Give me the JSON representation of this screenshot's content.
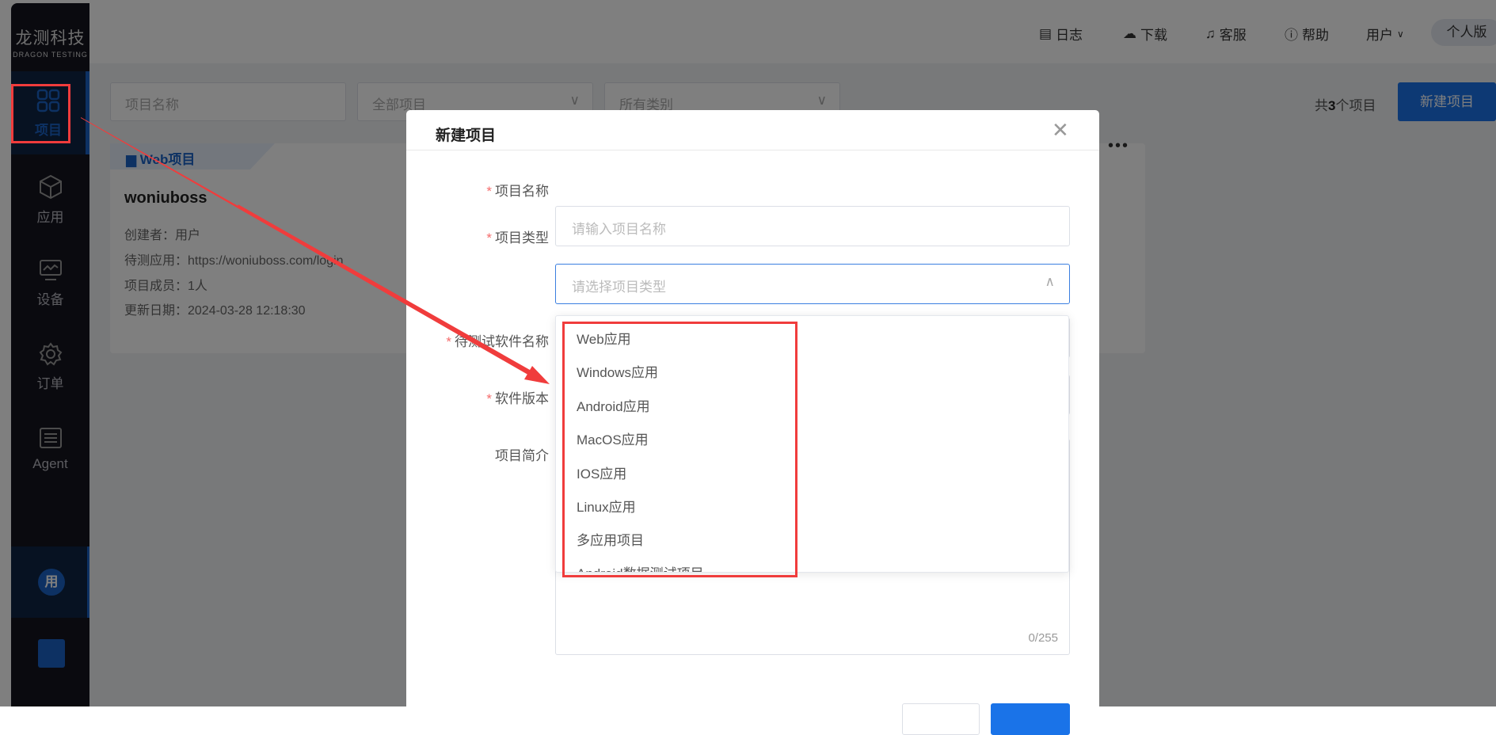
{
  "logo": {
    "cn": "龙测科技",
    "en": "DRAGON TESTING"
  },
  "sidebar": {
    "items": [
      {
        "label": "项目"
      },
      {
        "label": "应用"
      },
      {
        "label": "设备"
      },
      {
        "label": "订单"
      },
      {
        "label": "Agent"
      }
    ],
    "user_avatar": "用"
  },
  "header": {
    "log": "日志",
    "download": "下载",
    "service": "客服",
    "help": "帮助",
    "user": "用户",
    "edition": "个人版"
  },
  "filters": {
    "name_placeholder": "项目名称",
    "scope": "全部项目",
    "category": "所有类别",
    "count_prefix": "共",
    "count": "3",
    "count_suffix": "个项目",
    "new_button": "新建项目"
  },
  "card": {
    "tag": "Web项目",
    "name": "woniuboss",
    "lines": [
      "创建者：用户",
      "待测应用：https://woniuboss.com/login",
      "项目成员：1人",
      "更新日期：2024-03-28 12:18:30"
    ]
  },
  "modal": {
    "title": "新建项目",
    "fields": {
      "name_label": "项目名称",
      "name_placeholder": "请输入项目名称",
      "type_label": "项目类型",
      "type_placeholder": "请选择项目类型",
      "software_label": "待测试软件名称",
      "version_label": "软件版本",
      "desc_label": "项目简介",
      "desc_counter": "0/255"
    },
    "options": [
      "Web应用",
      "Windows应用",
      "Android应用",
      "MacOS应用",
      "IOS应用",
      "Linux应用",
      "多应用项目",
      "Android数据测试项目"
    ]
  }
}
